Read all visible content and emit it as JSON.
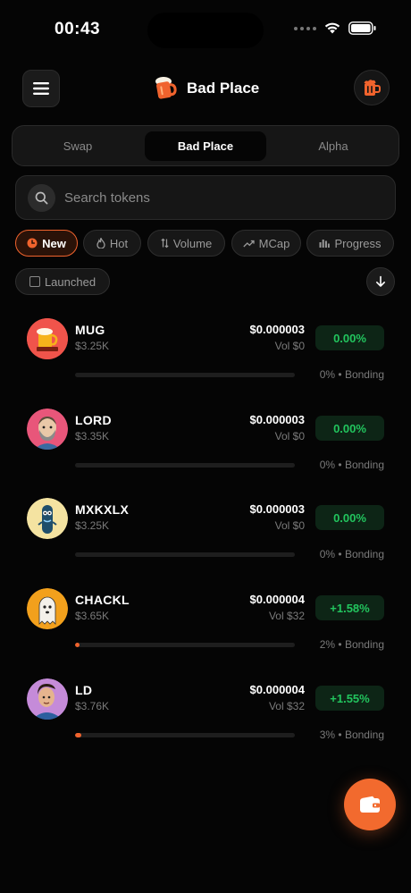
{
  "status_bar": {
    "time": "00:43"
  },
  "header": {
    "title": "Bad Place"
  },
  "tabs": [
    {
      "label": "Swap",
      "active": false
    },
    {
      "label": "Bad Place",
      "active": true
    },
    {
      "label": "Alpha",
      "active": false
    }
  ],
  "search": {
    "placeholder": "Search tokens"
  },
  "filters": [
    {
      "label": "New",
      "icon": "clock-icon",
      "active": true
    },
    {
      "label": "Hot",
      "icon": "flame-icon",
      "active": false
    },
    {
      "label": "Volume",
      "icon": "sort-arrows-icon",
      "active": false
    },
    {
      "label": "MCap",
      "icon": "trend-up-icon",
      "active": false
    },
    {
      "label": "Progress",
      "icon": "bar-chart-icon",
      "active": false
    }
  ],
  "launched_filter": {
    "label": "Launched",
    "checked": false
  },
  "tokens": [
    {
      "name": "MUG",
      "mcap": "$3.25K",
      "price": "$0.000003",
      "vol": "Vol $0",
      "change": "0.00%",
      "progress": 0,
      "bonding": "0% • Bonding",
      "avatar_color": "#f0544b"
    },
    {
      "name": "LORD",
      "mcap": "$3.35K",
      "price": "$0.000003",
      "vol": "Vol $0",
      "change": "0.00%",
      "progress": 0,
      "bonding": "0% • Bonding",
      "avatar_color": "#e8567a"
    },
    {
      "name": "MXKXLX",
      "mcap": "$3.25K",
      "price": "$0.000003",
      "vol": "Vol $0",
      "change": "0.00%",
      "progress": 0,
      "bonding": "0% • Bonding",
      "avatar_color": "#f4e3a1"
    },
    {
      "name": "CHACKL",
      "mcap": "$3.65K",
      "price": "$0.000004",
      "vol": "Vol $32",
      "change": "+1.58%",
      "progress": 2,
      "bonding": "2% • Bonding",
      "avatar_color": "#f2a01c"
    },
    {
      "name": "LD",
      "mcap": "$3.76K",
      "price": "$0.000004",
      "vol": "Vol $32",
      "change": "+1.55%",
      "progress": 3,
      "bonding": "3% • Bonding",
      "avatar_color": "#c58bd9"
    }
  ],
  "colors": {
    "accent": "#f0632d",
    "positive": "#22c55e",
    "background": "#050505"
  }
}
